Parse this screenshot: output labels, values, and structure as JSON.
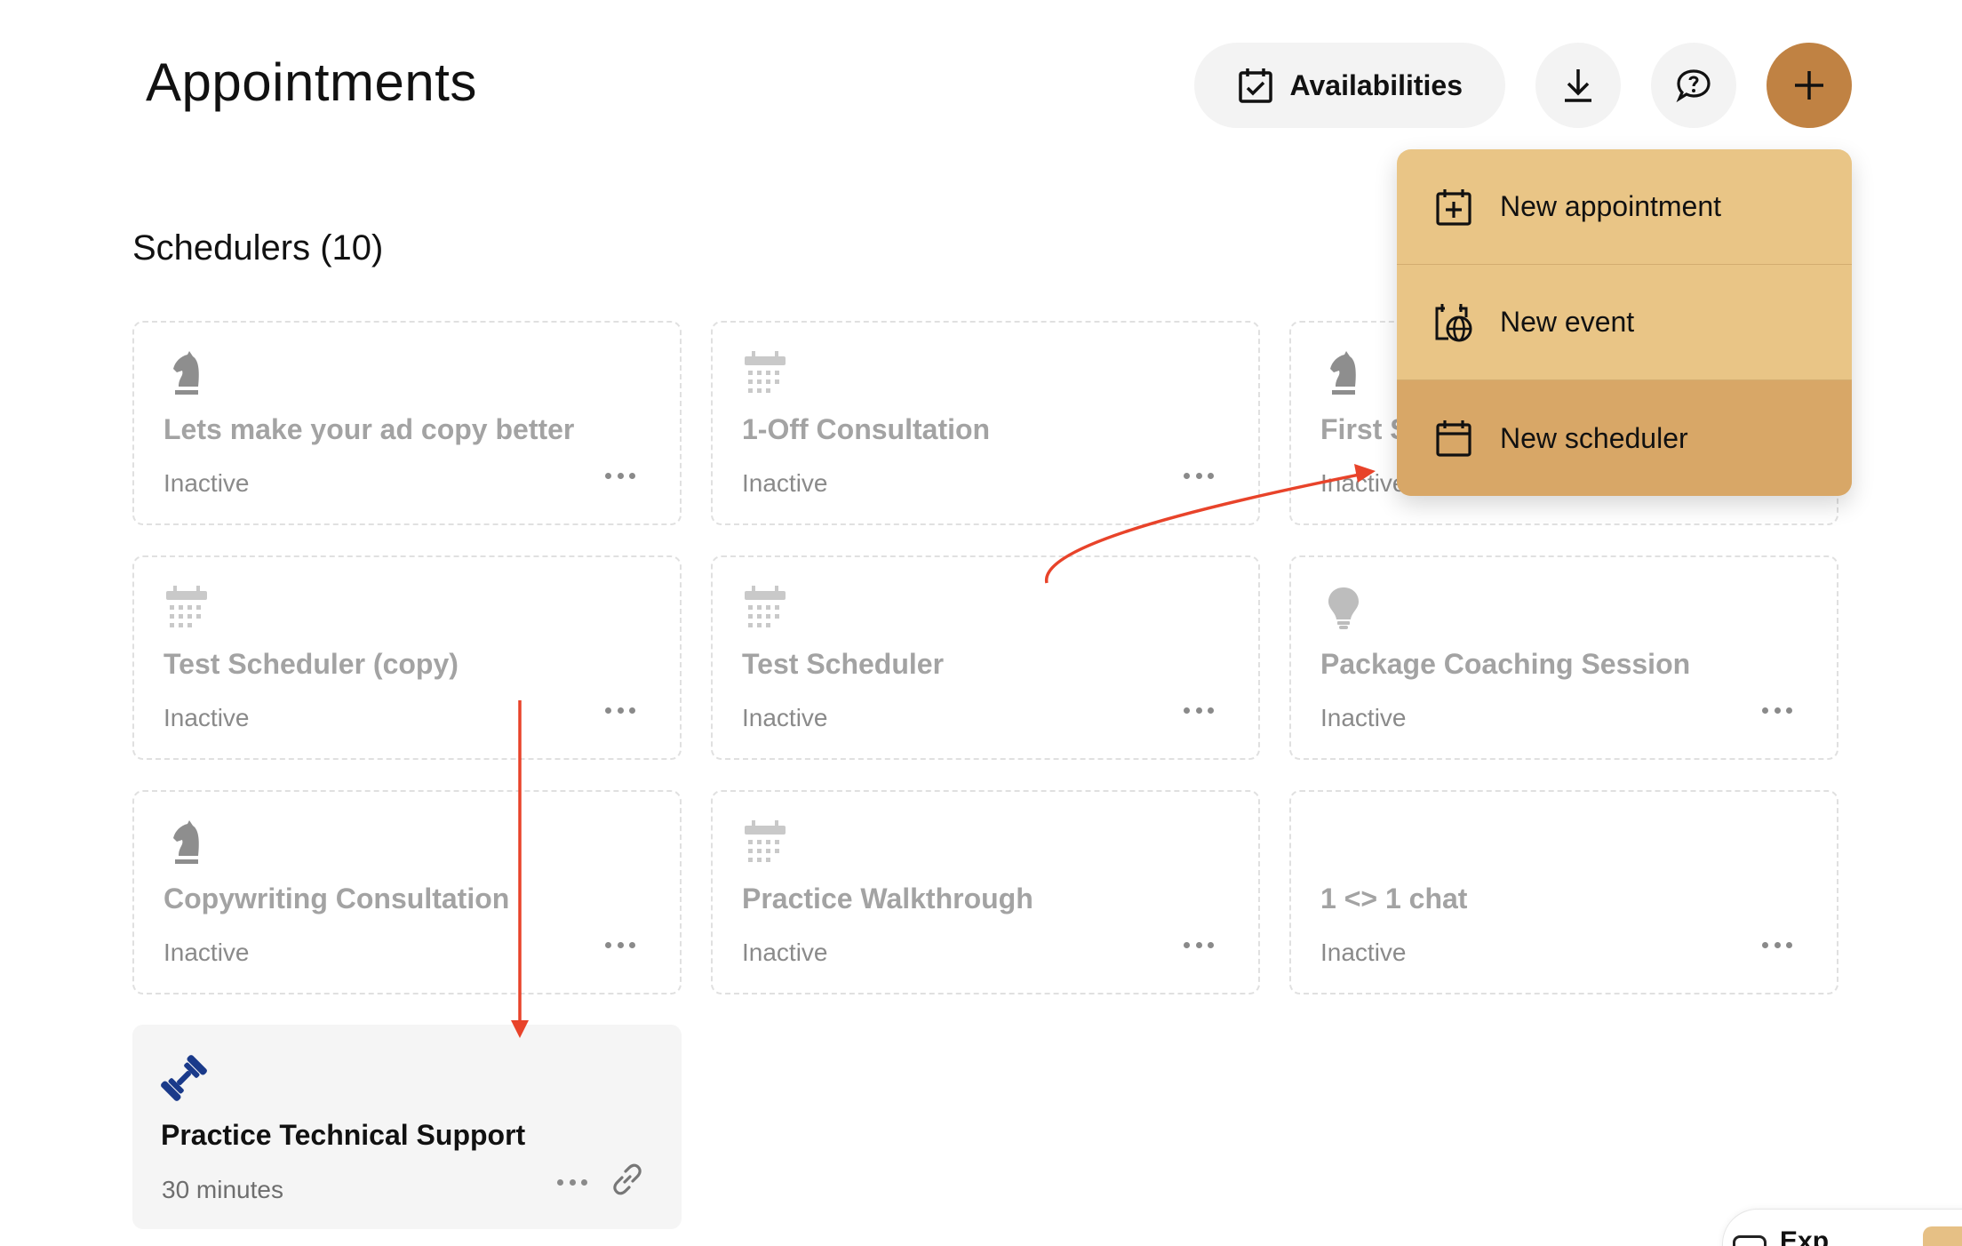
{
  "header": {
    "title": "Appointments",
    "availabilities_label": "Availabilities"
  },
  "section": {
    "title": "Schedulers (10)"
  },
  "schedulers": [
    {
      "title": "Lets make your ad copy better",
      "status": "Inactive",
      "icon": "chess-knight-icon"
    },
    {
      "title": "1-Off Consultation",
      "status": "Inactive",
      "icon": "calendar-icon"
    },
    {
      "title": "First S",
      "status": "Inactive",
      "icon": "chess-knight-icon"
    },
    {
      "title": "Test Scheduler (copy)",
      "status": "Inactive",
      "icon": "calendar-icon"
    },
    {
      "title": "Test Scheduler",
      "status": "Inactive",
      "icon": "calendar-icon"
    },
    {
      "title": "Package Coaching Session",
      "status": "Inactive",
      "icon": "lightbulb-icon"
    },
    {
      "title": "Copywriting Consultation",
      "status": "Inactive",
      "icon": "chess-knight-icon"
    },
    {
      "title": "Practice Walkthrough",
      "status": "Inactive",
      "icon": "calendar-icon"
    },
    {
      "title": "1 <> 1 chat",
      "status": "Inactive",
      "icon": ""
    },
    {
      "title": "Practice Technical Support",
      "status": "30 minutes",
      "icon": "dumbbell-icon"
    }
  ],
  "menu": {
    "items": [
      {
        "label": "New appointment",
        "icon": "calendar-plus-icon"
      },
      {
        "label": "New event",
        "icon": "calendar-globe-icon"
      },
      {
        "label": "New scheduler",
        "icon": "calendar-icon"
      }
    ]
  },
  "corner_widget": {
    "text": "Exp"
  },
  "colors": {
    "primary": "#c08243",
    "menu_bg": "#e9c586",
    "menu_hover": "#d8a767",
    "annotation_arrow": "#e8432a",
    "active_icon": "#1a3a8a"
  }
}
